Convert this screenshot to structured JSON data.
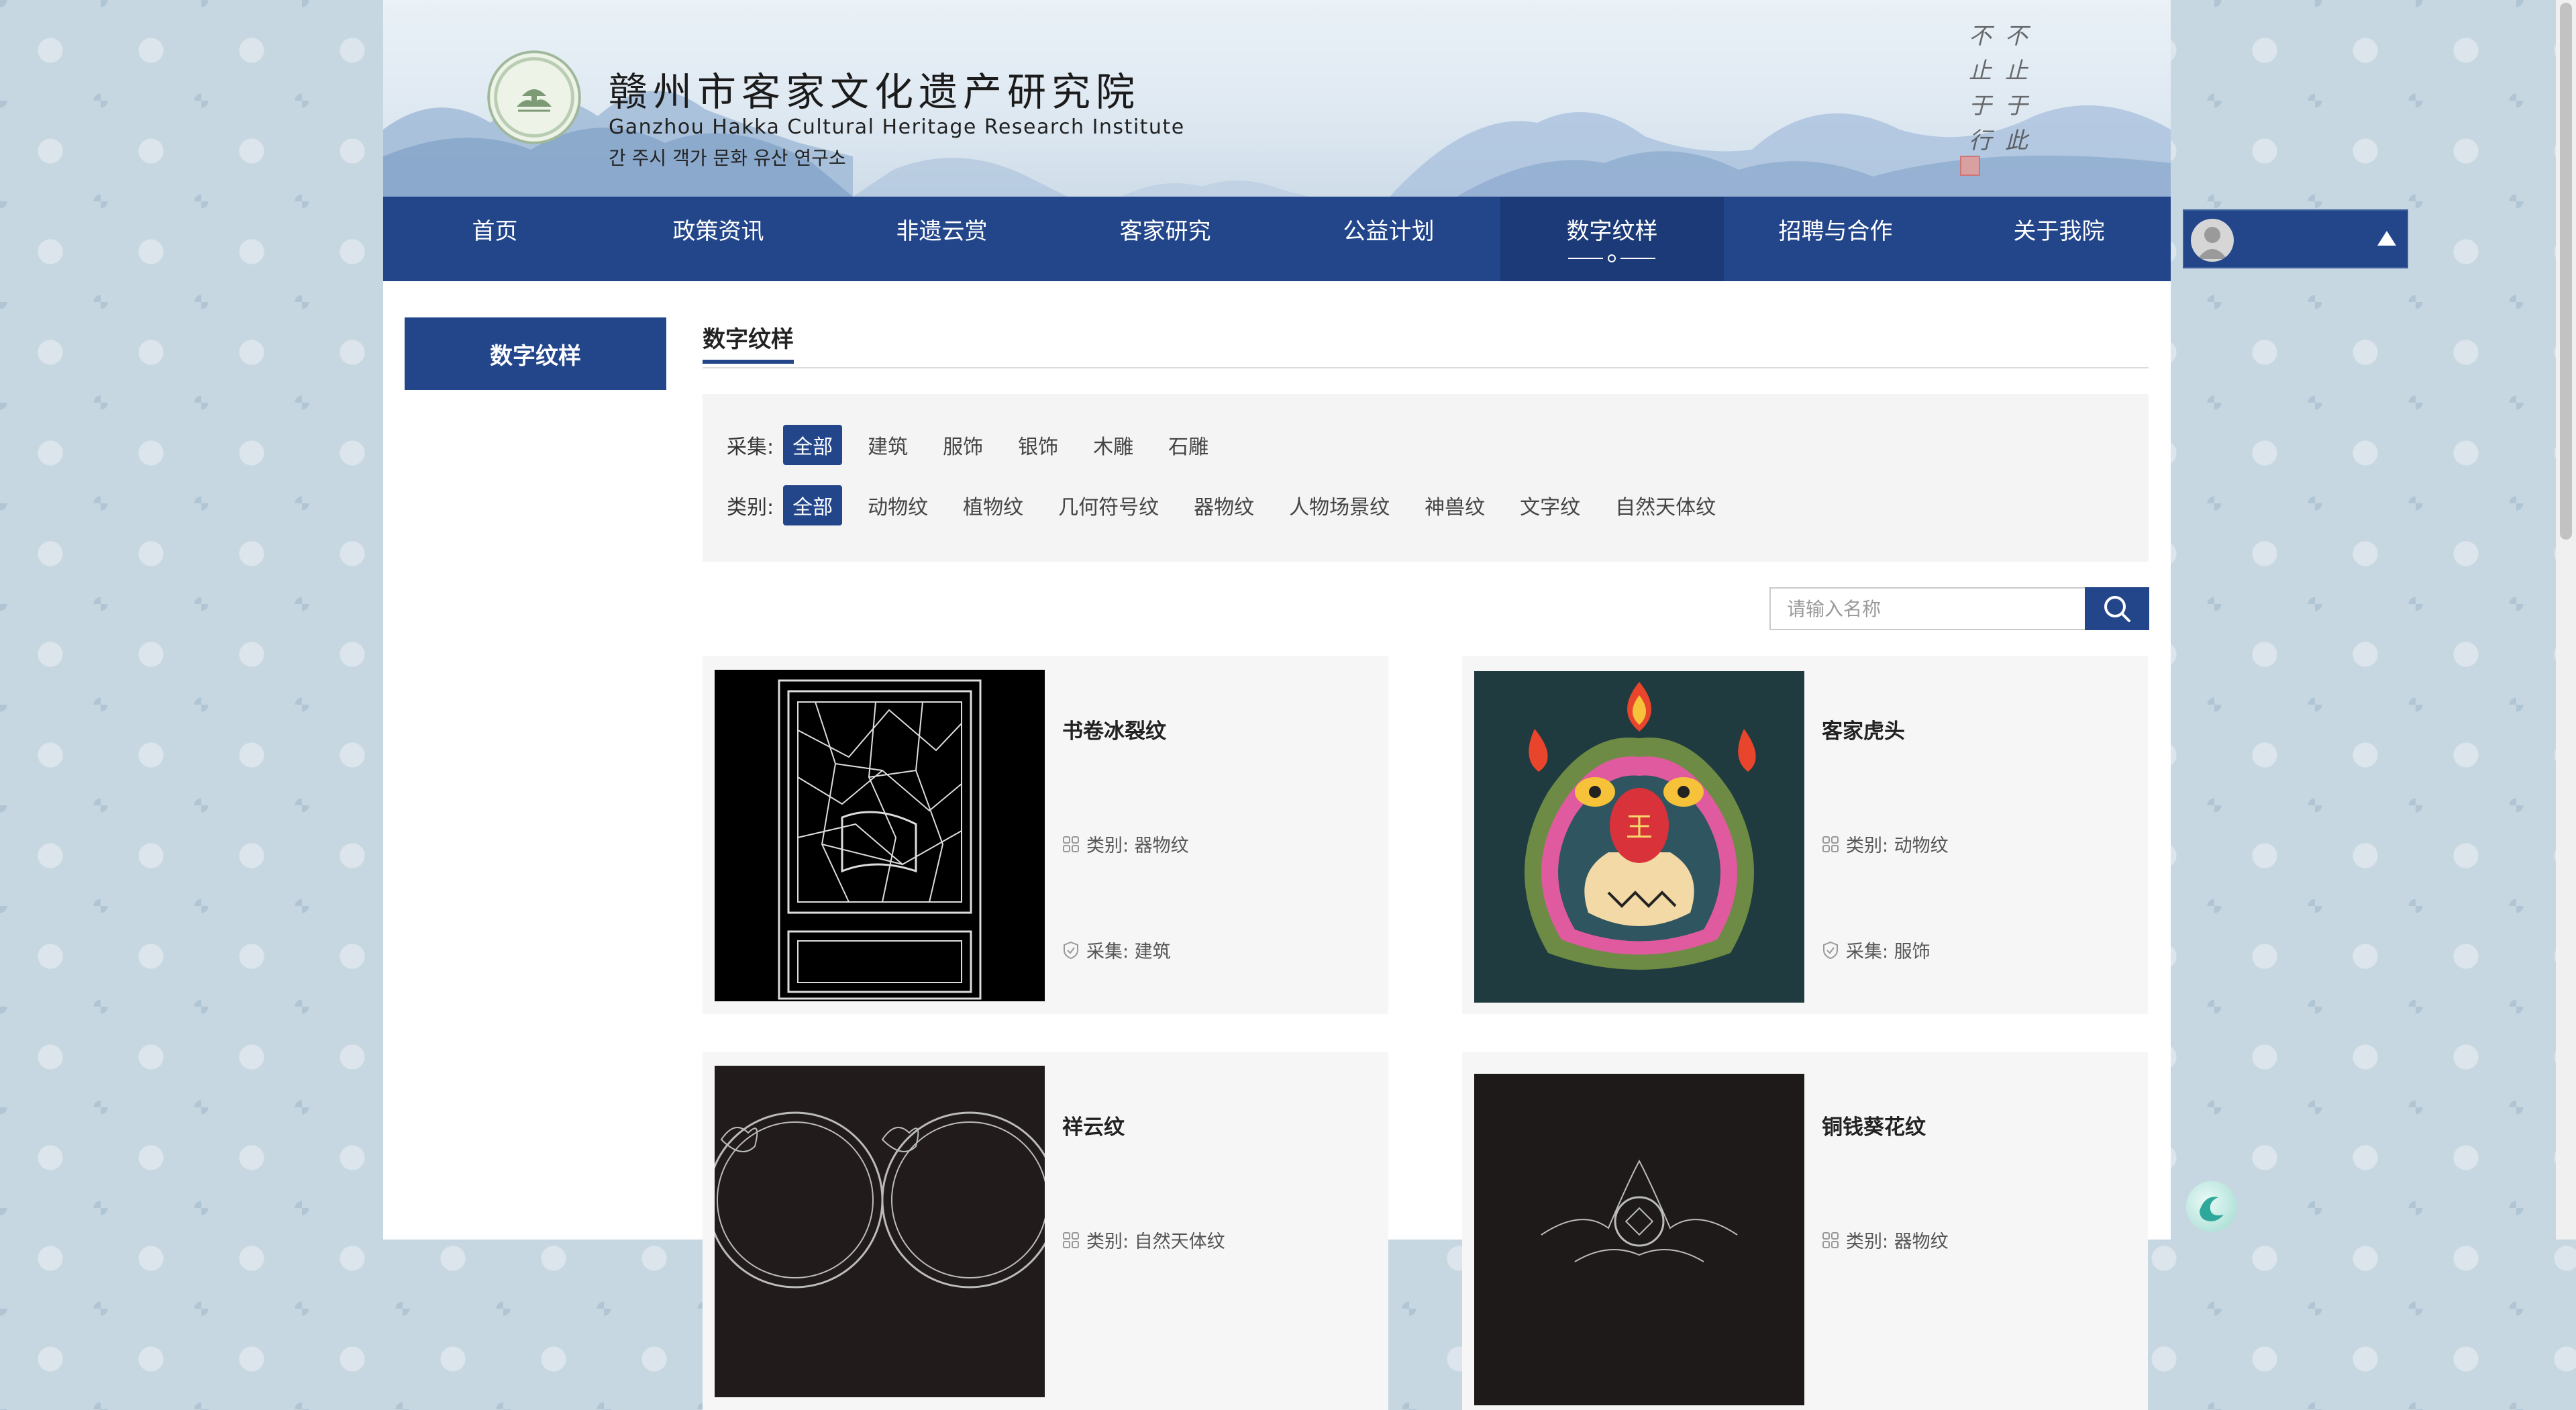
{
  "header": {
    "title_cn": "赣州市客家文化遗产研究院",
    "title_en": "Ganzhou Hakka Cultural Heritage Research Institute",
    "title_kr": "간 주시 객가 문화 유산 연구소",
    "calligraphy_left": "不止于行",
    "calligraphy_right": "不止于此"
  },
  "nav": {
    "items": [
      {
        "label": "首页"
      },
      {
        "label": "政策资讯"
      },
      {
        "label": "非遗云赏"
      },
      {
        "label": "客家研究"
      },
      {
        "label": "公益计划"
      },
      {
        "label": "数字纹样"
      },
      {
        "label": "招聘与合作"
      },
      {
        "label": "关于我院"
      }
    ],
    "active_index": 5
  },
  "sidebar": {
    "tab_label": "数字纹样"
  },
  "section": {
    "title": "数字纹样"
  },
  "filters": {
    "collect": {
      "label": "采集:",
      "options": [
        "全部",
        "建筑",
        "服饰",
        "银饰",
        "木雕",
        "石雕"
      ],
      "selected": "全部"
    },
    "category": {
      "label": "类别:",
      "options": [
        "全部",
        "动物纹",
        "植物纹",
        "几何符号纹",
        "器物纹",
        "人物场景纹",
        "神兽纹",
        "文字纹",
        "自然天体纹"
      ],
      "selected": "全部"
    }
  },
  "search": {
    "placeholder": "请输入名称"
  },
  "cards": [
    {
      "name": "书卷冰裂纹",
      "category": "类别: 器物纹",
      "collect": "采集: 建筑"
    },
    {
      "name": "客家虎头",
      "category": "类别: 动物纹",
      "collect": "采集: 服饰"
    },
    {
      "name": "祥云纹",
      "category": "类别: 自然天体纹",
      "collect": ""
    },
    {
      "name": "铜钱葵花纹",
      "category": "类别: 器物纹",
      "collect": ""
    }
  ],
  "tiger_mark": "王",
  "colors": {
    "primary": "#23468b",
    "primary_dark": "#1b3a77",
    "filter_bg": "#f4f4f4",
    "card_bg": "#f6f6f6",
    "page_bg": "#c7d7e1"
  },
  "icons": {
    "search": "search-icon",
    "category": "grid-icon",
    "collect": "shield-icon",
    "user": "user-avatar-icon",
    "dropdown": "caret-up-icon"
  }
}
